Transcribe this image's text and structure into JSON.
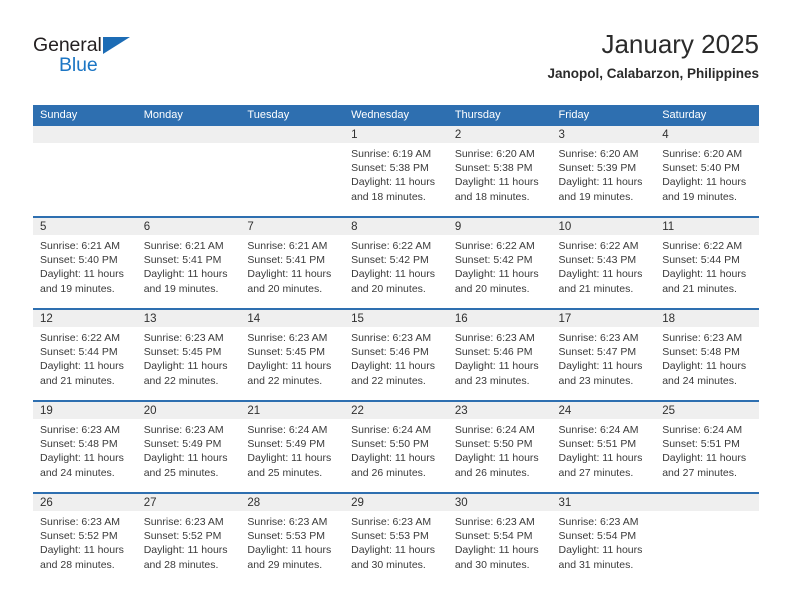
{
  "logo": {
    "word_general": "General",
    "word_blue": "Blue",
    "triangle_color": "#1c6cb5",
    "blue_text_color": "#1c76c4"
  },
  "header": {
    "title": "January 2025",
    "subtitle": "Janopol, Calabarzon, Philippines",
    "header_bg_color": "#2e6fb0",
    "daynum_band_color": "#efefef"
  },
  "weekday_headers": [
    "Sunday",
    "Monday",
    "Tuesday",
    "Wednesday",
    "Thursday",
    "Friday",
    "Saturday"
  ],
  "weeks": [
    [
      {
        "day": "",
        "sunrise": "",
        "sunset": "",
        "daylight_line1": "",
        "daylight_line2": ""
      },
      {
        "day": "",
        "sunrise": "",
        "sunset": "",
        "daylight_line1": "",
        "daylight_line2": ""
      },
      {
        "day": "",
        "sunrise": "",
        "sunset": "",
        "daylight_line1": "",
        "daylight_line2": ""
      },
      {
        "day": "1",
        "sunrise": "Sunrise: 6:19 AM",
        "sunset": "Sunset: 5:38 PM",
        "daylight_line1": "Daylight: 11 hours",
        "daylight_line2": "and 18 minutes."
      },
      {
        "day": "2",
        "sunrise": "Sunrise: 6:20 AM",
        "sunset": "Sunset: 5:38 PM",
        "daylight_line1": "Daylight: 11 hours",
        "daylight_line2": "and 18 minutes."
      },
      {
        "day": "3",
        "sunrise": "Sunrise: 6:20 AM",
        "sunset": "Sunset: 5:39 PM",
        "daylight_line1": "Daylight: 11 hours",
        "daylight_line2": "and 19 minutes."
      },
      {
        "day": "4",
        "sunrise": "Sunrise: 6:20 AM",
        "sunset": "Sunset: 5:40 PM",
        "daylight_line1": "Daylight: 11 hours",
        "daylight_line2": "and 19 minutes."
      }
    ],
    [
      {
        "day": "5",
        "sunrise": "Sunrise: 6:21 AM",
        "sunset": "Sunset: 5:40 PM",
        "daylight_line1": "Daylight: 11 hours",
        "daylight_line2": "and 19 minutes."
      },
      {
        "day": "6",
        "sunrise": "Sunrise: 6:21 AM",
        "sunset": "Sunset: 5:41 PM",
        "daylight_line1": "Daylight: 11 hours",
        "daylight_line2": "and 19 minutes."
      },
      {
        "day": "7",
        "sunrise": "Sunrise: 6:21 AM",
        "sunset": "Sunset: 5:41 PM",
        "daylight_line1": "Daylight: 11 hours",
        "daylight_line2": "and 20 minutes."
      },
      {
        "day": "8",
        "sunrise": "Sunrise: 6:22 AM",
        "sunset": "Sunset: 5:42 PM",
        "daylight_line1": "Daylight: 11 hours",
        "daylight_line2": "and 20 minutes."
      },
      {
        "day": "9",
        "sunrise": "Sunrise: 6:22 AM",
        "sunset": "Sunset: 5:42 PM",
        "daylight_line1": "Daylight: 11 hours",
        "daylight_line2": "and 20 minutes."
      },
      {
        "day": "10",
        "sunrise": "Sunrise: 6:22 AM",
        "sunset": "Sunset: 5:43 PM",
        "daylight_line1": "Daylight: 11 hours",
        "daylight_line2": "and 21 minutes."
      },
      {
        "day": "11",
        "sunrise": "Sunrise: 6:22 AM",
        "sunset": "Sunset: 5:44 PM",
        "daylight_line1": "Daylight: 11 hours",
        "daylight_line2": "and 21 minutes."
      }
    ],
    [
      {
        "day": "12",
        "sunrise": "Sunrise: 6:22 AM",
        "sunset": "Sunset: 5:44 PM",
        "daylight_line1": "Daylight: 11 hours",
        "daylight_line2": "and 21 minutes."
      },
      {
        "day": "13",
        "sunrise": "Sunrise: 6:23 AM",
        "sunset": "Sunset: 5:45 PM",
        "daylight_line1": "Daylight: 11 hours",
        "daylight_line2": "and 22 minutes."
      },
      {
        "day": "14",
        "sunrise": "Sunrise: 6:23 AM",
        "sunset": "Sunset: 5:45 PM",
        "daylight_line1": "Daylight: 11 hours",
        "daylight_line2": "and 22 minutes."
      },
      {
        "day": "15",
        "sunrise": "Sunrise: 6:23 AM",
        "sunset": "Sunset: 5:46 PM",
        "daylight_line1": "Daylight: 11 hours",
        "daylight_line2": "and 22 minutes."
      },
      {
        "day": "16",
        "sunrise": "Sunrise: 6:23 AM",
        "sunset": "Sunset: 5:46 PM",
        "daylight_line1": "Daylight: 11 hours",
        "daylight_line2": "and 23 minutes."
      },
      {
        "day": "17",
        "sunrise": "Sunrise: 6:23 AM",
        "sunset": "Sunset: 5:47 PM",
        "daylight_line1": "Daylight: 11 hours",
        "daylight_line2": "and 23 minutes."
      },
      {
        "day": "18",
        "sunrise": "Sunrise: 6:23 AM",
        "sunset": "Sunset: 5:48 PM",
        "daylight_line1": "Daylight: 11 hours",
        "daylight_line2": "and 24 minutes."
      }
    ],
    [
      {
        "day": "19",
        "sunrise": "Sunrise: 6:23 AM",
        "sunset": "Sunset: 5:48 PM",
        "daylight_line1": "Daylight: 11 hours",
        "daylight_line2": "and 24 minutes."
      },
      {
        "day": "20",
        "sunrise": "Sunrise: 6:23 AM",
        "sunset": "Sunset: 5:49 PM",
        "daylight_line1": "Daylight: 11 hours",
        "daylight_line2": "and 25 minutes."
      },
      {
        "day": "21",
        "sunrise": "Sunrise: 6:24 AM",
        "sunset": "Sunset: 5:49 PM",
        "daylight_line1": "Daylight: 11 hours",
        "daylight_line2": "and 25 minutes."
      },
      {
        "day": "22",
        "sunrise": "Sunrise: 6:24 AM",
        "sunset": "Sunset: 5:50 PM",
        "daylight_line1": "Daylight: 11 hours",
        "daylight_line2": "and 26 minutes."
      },
      {
        "day": "23",
        "sunrise": "Sunrise: 6:24 AM",
        "sunset": "Sunset: 5:50 PM",
        "daylight_line1": "Daylight: 11 hours",
        "daylight_line2": "and 26 minutes."
      },
      {
        "day": "24",
        "sunrise": "Sunrise: 6:24 AM",
        "sunset": "Sunset: 5:51 PM",
        "daylight_line1": "Daylight: 11 hours",
        "daylight_line2": "and 27 minutes."
      },
      {
        "day": "25",
        "sunrise": "Sunrise: 6:24 AM",
        "sunset": "Sunset: 5:51 PM",
        "daylight_line1": "Daylight: 11 hours",
        "daylight_line2": "and 27 minutes."
      }
    ],
    [
      {
        "day": "26",
        "sunrise": "Sunrise: 6:23 AM",
        "sunset": "Sunset: 5:52 PM",
        "daylight_line1": "Daylight: 11 hours",
        "daylight_line2": "and 28 minutes."
      },
      {
        "day": "27",
        "sunrise": "Sunrise: 6:23 AM",
        "sunset": "Sunset: 5:52 PM",
        "daylight_line1": "Daylight: 11 hours",
        "daylight_line2": "and 28 minutes."
      },
      {
        "day": "28",
        "sunrise": "Sunrise: 6:23 AM",
        "sunset": "Sunset: 5:53 PM",
        "daylight_line1": "Daylight: 11 hours",
        "daylight_line2": "and 29 minutes."
      },
      {
        "day": "29",
        "sunrise": "Sunrise: 6:23 AM",
        "sunset": "Sunset: 5:53 PM",
        "daylight_line1": "Daylight: 11 hours",
        "daylight_line2": "and 30 minutes."
      },
      {
        "day": "30",
        "sunrise": "Sunrise: 6:23 AM",
        "sunset": "Sunset: 5:54 PM",
        "daylight_line1": "Daylight: 11 hours",
        "daylight_line2": "and 30 minutes."
      },
      {
        "day": "31",
        "sunrise": "Sunrise: 6:23 AM",
        "sunset": "Sunset: 5:54 PM",
        "daylight_line1": "Daylight: 11 hours",
        "daylight_line2": "and 31 minutes."
      },
      {
        "day": "",
        "sunrise": "",
        "sunset": "",
        "daylight_line1": "",
        "daylight_line2": ""
      }
    ]
  ]
}
